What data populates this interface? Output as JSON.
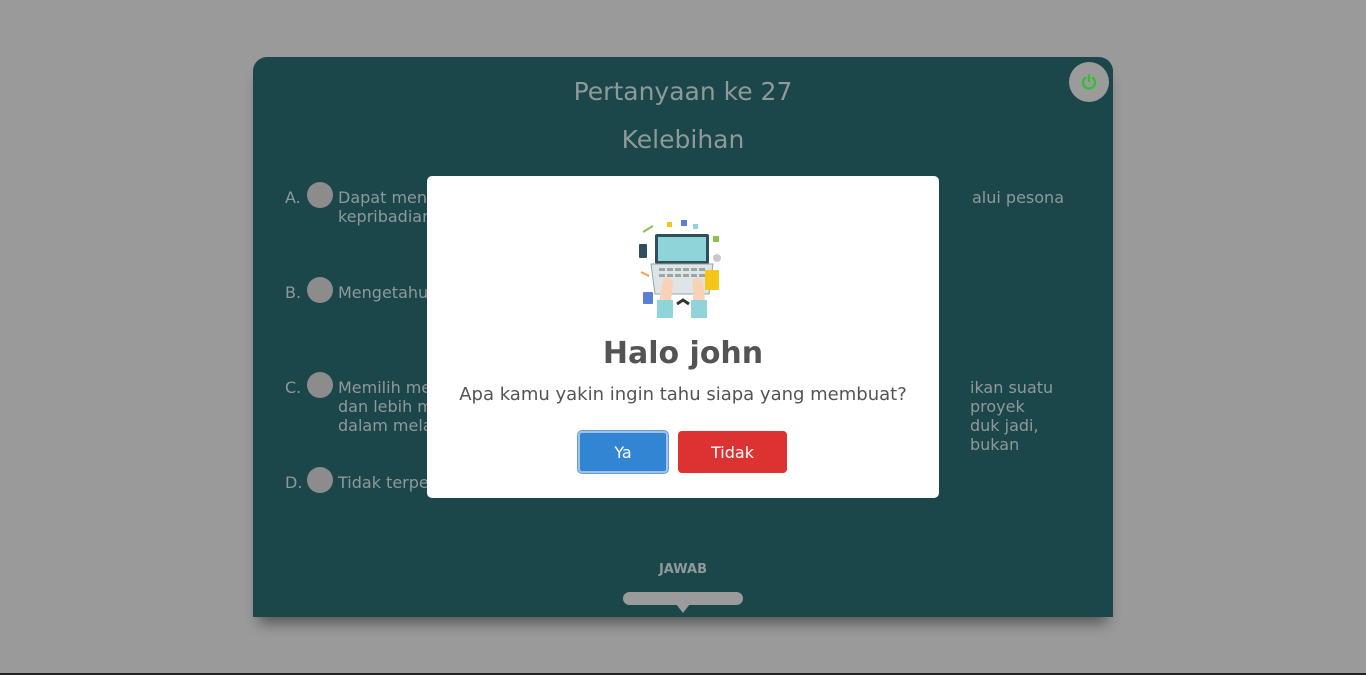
{
  "quiz": {
    "title": "Pertanyaan ke 27",
    "subtitle": "Kelebihan",
    "options": [
      {
        "letter": "A.",
        "text_left": "Dapat men",
        "text_left_2": "kepribadiar",
        "text_right": "alui pesona"
      },
      {
        "letter": "B.",
        "text_left": "Mengetahu"
      },
      {
        "letter": "C.",
        "text_left": "Memilih me",
        "text_left_2": "dan lebih m",
        "text_left_3": "dalam mela",
        "text_right": "ikan suatu proyek",
        "text_right_2": "duk jadi, bukan"
      },
      {
        "letter": "D.",
        "text_left": "Tidak terpe"
      }
    ],
    "submit_label": "JAWAB"
  },
  "modal": {
    "title": "Halo john",
    "message": "Apa kamu yakin ingin tahu siapa yang membuat?",
    "confirm_label": "Ya",
    "cancel_label": "Tidak"
  },
  "icons": {
    "power": "power-icon",
    "illustration": "laptop-workspace-illustration"
  },
  "colors": {
    "overlay": "#9a9a9a",
    "card": "#1b474a",
    "confirm": "#3185d3",
    "cancel": "#dc3232",
    "power": "#2ec02e"
  }
}
